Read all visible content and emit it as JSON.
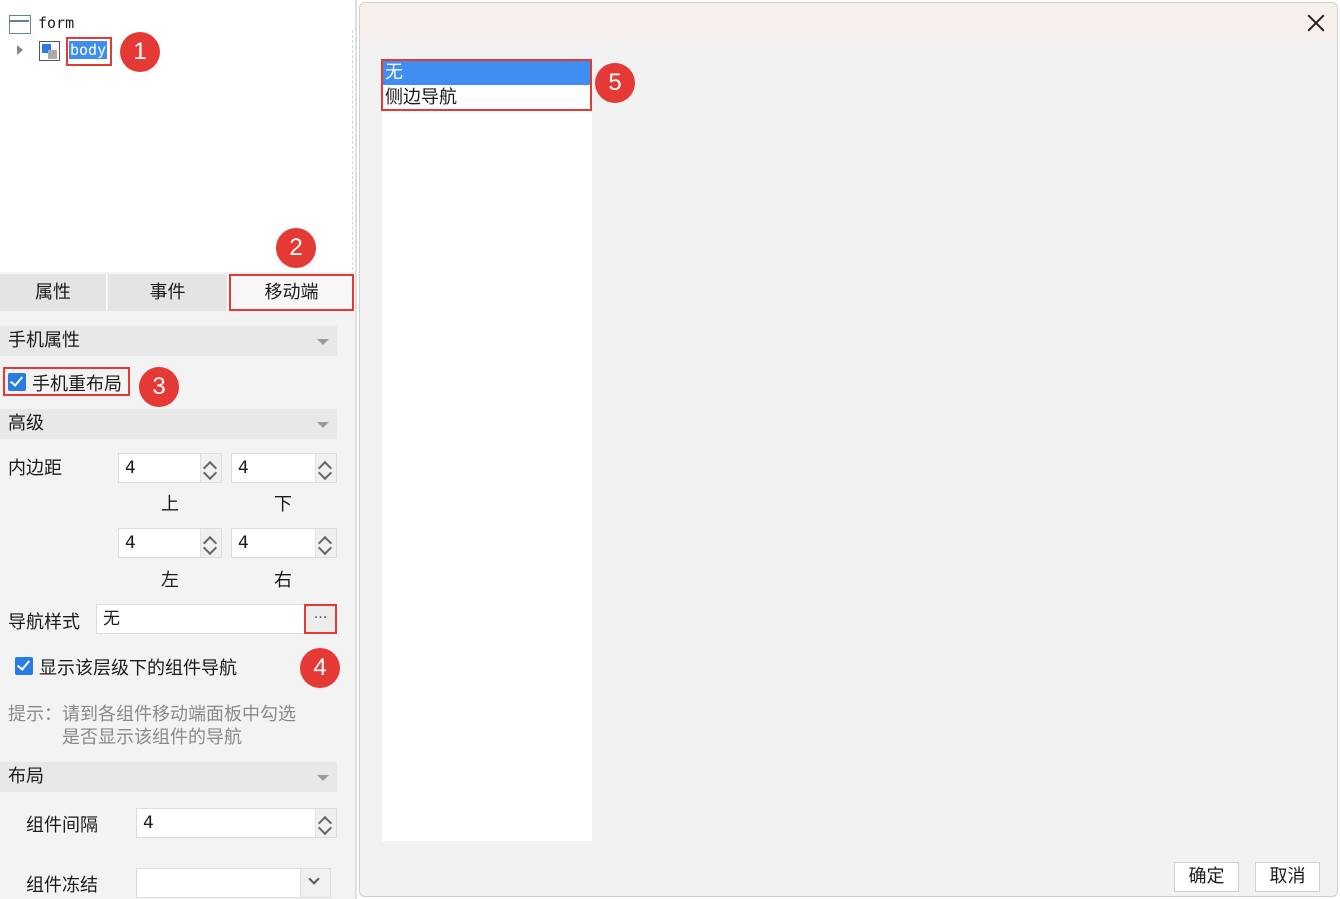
{
  "tree": {
    "root_label": "form",
    "child_label": "body"
  },
  "tabs": [
    {
      "label": "属性"
    },
    {
      "label": "事件"
    },
    {
      "label": "移动端"
    }
  ],
  "sections": {
    "phone_props": "手机属性",
    "advanced": "高级",
    "layout": "布局"
  },
  "phone_relayout": {
    "label": "手机重布局",
    "checked": true
  },
  "padding": {
    "label": "内边距",
    "top": "4",
    "bottom": "4",
    "left": "4",
    "right": "4",
    "top_label": "上",
    "bottom_label": "下",
    "left_label": "左",
    "right_label": "右"
  },
  "nav_style": {
    "label": "导航样式",
    "value": "无",
    "button": "···"
  },
  "show_nav": {
    "label": "显示该层级下的组件导航",
    "checked": true
  },
  "hint": {
    "line1": "提示：请到各组件移动端面板中勾选",
    "line2": "是否显示该组件的导航"
  },
  "layout_fields": {
    "gap_label": "组件间隔",
    "gap_value": "4",
    "freeze_label": "组件冻结",
    "freeze_value": ""
  },
  "badges": [
    "1",
    "2",
    "3",
    "4",
    "5"
  ],
  "dialog": {
    "options": [
      "无",
      "侧边导航"
    ],
    "selected": "无",
    "ok": "确定",
    "cancel": "取消"
  },
  "colors": {
    "accent": "#2a7be4",
    "selection": "#3d8ef0",
    "badge": "#e53935"
  }
}
